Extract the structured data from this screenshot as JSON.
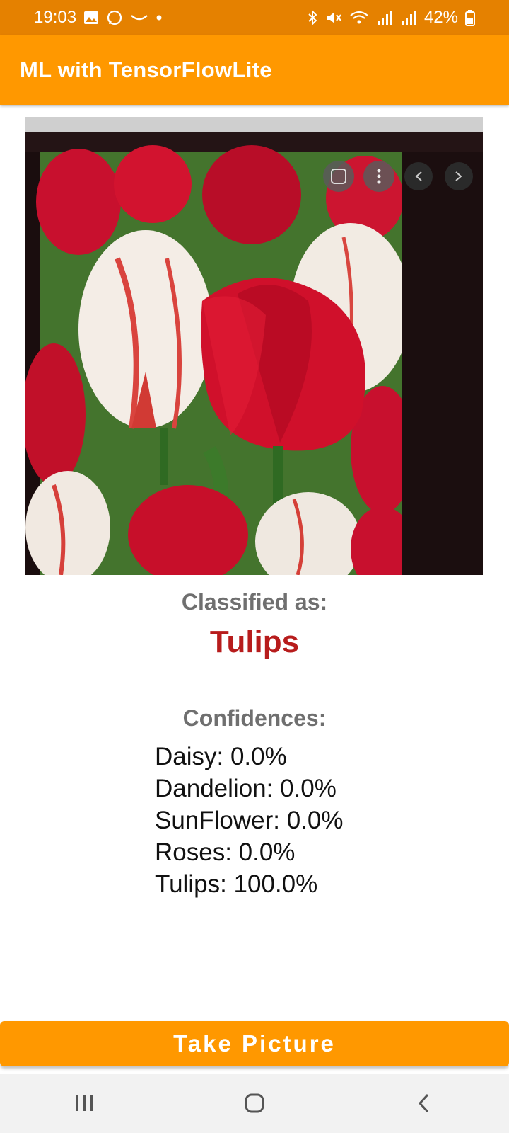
{
  "status_bar": {
    "time": "19:03",
    "battery": "42%",
    "icons_left": [
      "gallery-icon",
      "whatsapp-icon",
      "smile-icon",
      "dot-icon"
    ],
    "icons_right": [
      "bluetooth-icon",
      "mute-icon",
      "wifi-icon",
      "signal-icon",
      "signal-icon",
      "battery-icon"
    ]
  },
  "app_bar": {
    "title": "ML with TensorFlowLite"
  },
  "photo": {
    "subject": "tulips"
  },
  "classification": {
    "label": "Classified as:",
    "value": "Tulips"
  },
  "confidences": {
    "label": "Confidences:",
    "items": [
      "Daisy: 0.0%",
      "Dandelion: 0.0%",
      "SunFlower: 0.0%",
      "Roses: 0.0%",
      "Tulips: 100.0%"
    ]
  },
  "button": {
    "label": "Take Picture"
  },
  "nav_bar": {
    "icons": [
      "recent-apps-icon",
      "home-icon",
      "back-icon"
    ]
  },
  "colors": {
    "primary": "#FF9800",
    "status_bar": "#E58100",
    "result": "#B71C1C",
    "label_gray": "#6f6f6f"
  }
}
